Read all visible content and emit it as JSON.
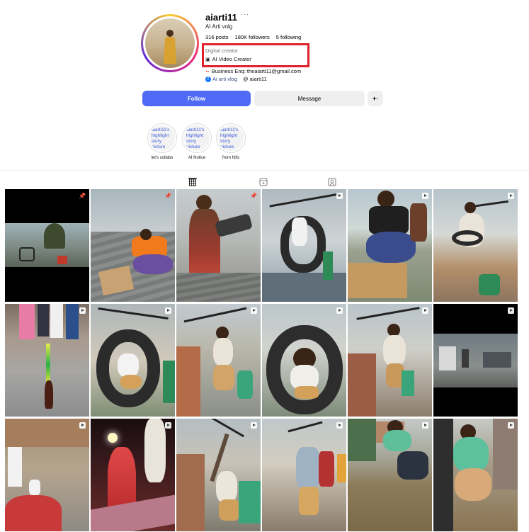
{
  "profile": {
    "username": "aiarti11",
    "full_name": "AI Arti volg",
    "stats": {
      "posts": "316 posts",
      "followers": "180K followers",
      "following": "5 following"
    },
    "category": "Digital creator",
    "bio_line1": "AI Video Creator",
    "bio_line2": "Business Enq: theaiarti11@gmail.com",
    "link_facebook": "Ai arti vlog",
    "link_threads": "aiarti11"
  },
  "buttons": {
    "follow": "Follow",
    "message": "Message",
    "suggest": "+·"
  },
  "highlights": [
    {
      "cover_text": "aiarti11's highlight story picture",
      "label": "let's collabs"
    },
    {
      "cover_text": "aiarti11's highlight story picture",
      "label": "AI Notice"
    },
    {
      "cover_text": "aiarti11's highlight story picture",
      "label": "from hills"
    }
  ],
  "tabs": [
    {
      "icon": "grid-icon",
      "active": true
    },
    {
      "icon": "reels-icon",
      "active": false
    },
    {
      "icon": "tagged-icon",
      "active": false
    }
  ],
  "posts": [
    {
      "badge": "pinned",
      "scene": "rain-street-black-frame"
    },
    {
      "badge": "pinned",
      "scene": "woman-orange-roof-boxes"
    },
    {
      "badge": "pinned",
      "scene": "woman-saree-rotor"
    },
    {
      "badge": "reel",
      "scene": "tire-helicopter-roof"
    },
    {
      "badge": "reel",
      "scene": "woman-black-box-roof"
    },
    {
      "badge": "reel",
      "scene": "man-rooftop-tire"
    },
    {
      "badge": "reel",
      "scene": "rocket-bottle-street"
    },
    {
      "badge": "reel",
      "scene": "woman-inside-tire"
    },
    {
      "badge": "reel",
      "scene": "man-rotor-street-above"
    },
    {
      "badge": "reel",
      "scene": "man-inside-tire"
    },
    {
      "badge": "reel",
      "scene": "man-rotor-balcony"
    },
    {
      "badge": "reel",
      "scene": "cctv-room-black-frame"
    },
    {
      "badge": "reel",
      "scene": "man-car-street"
    },
    {
      "badge": "reel",
      "scene": "woman-red-stage"
    },
    {
      "badge": "reel",
      "scene": "man-rotor-alley"
    },
    {
      "badge": "reel",
      "scene": "two-men-rotor"
    },
    {
      "badge": "reel",
      "scene": "man-jump-flood"
    },
    {
      "badge": "reel",
      "scene": "man-green-flood"
    }
  ],
  "colors": {
    "follow_bg": "#4f6bf5",
    "highlight_border": "#e0202a"
  }
}
